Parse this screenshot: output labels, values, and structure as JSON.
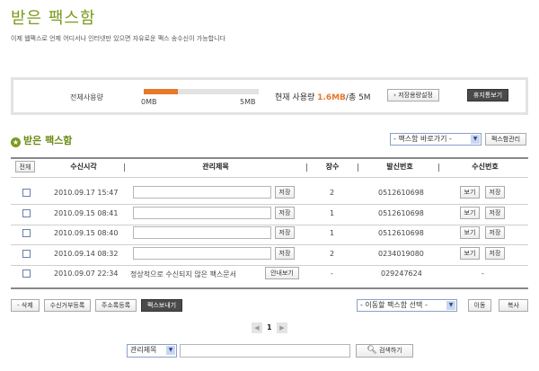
{
  "header": {
    "title": "받은 팩스함",
    "description": "이제 웹팩스로 언제 어디서나 인터넷만 있으면 자유로운 팩스 송수신이 가능합니다"
  },
  "usage": {
    "label": "전체사용량",
    "bar_fraction": 0.3,
    "min_label": "0MB",
    "max_label": "5MB",
    "current_prefix": "현재 사용량",
    "current_value": "1.6MB",
    "total_text": "/총 5M",
    "settings_button": "저장용량설정",
    "trash_button": "휴지통보기"
  },
  "section": {
    "title": "받은 팩스함",
    "star_icon": "star-icon",
    "shortcut_select": "- 팩스함 바로가기 -",
    "manage_button": "팩스함관리"
  },
  "table": {
    "headers": {
      "all": "전체",
      "time": "수신시각",
      "title": "관리제목",
      "pages": "장수",
      "sender": "발신번호",
      "receive": "수신번호"
    },
    "rows": [
      {
        "time": "2010.09.17 15:47",
        "save": "저장",
        "pages": "2",
        "sender": "0512610698",
        "view": "보기",
        "store": "저장"
      },
      {
        "time": "2010.09.15 08:41",
        "save": "저장",
        "pages": "1",
        "sender": "0512610698",
        "view": "보기",
        "store": "저장"
      },
      {
        "time": "2010.09.15 08:40",
        "save": "저장",
        "pages": "1",
        "sender": "0512610698",
        "view": "보기",
        "store": "저장"
      },
      {
        "time": "2010.09.14 08:32",
        "save": "저장",
        "pages": "2",
        "sender": "0234019080",
        "view": "보기",
        "store": "저장"
      }
    ],
    "failed_row": {
      "time": "2010.09.07 22:34",
      "message": "정상적으로 수신되지 않은 팩스문서",
      "guide_button": "안내보기",
      "pages": "-",
      "sender": "029247624",
      "receive": "-"
    }
  },
  "actions": {
    "delete": "- 삭제",
    "reject": "수신거부등록",
    "address": "주소록등록",
    "send": "팩스보내기",
    "move_select": "- 이동할 팩스함 선택 -",
    "move": "이동",
    "copy": "복사"
  },
  "pagination": {
    "current": "1"
  },
  "search": {
    "field_select": "관리제목",
    "button": "검색하기"
  }
}
